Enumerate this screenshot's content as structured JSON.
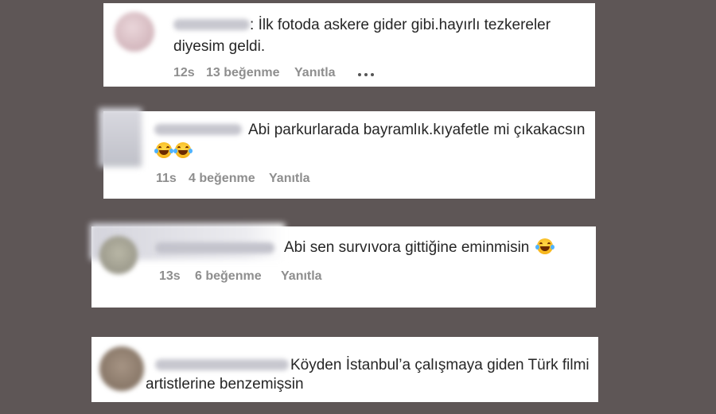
{
  "comments": [
    {
      "text_lines": [
        "İlk fotoda askere gider gibi.hayırlı tezkereler",
        "diyesim geldi."
      ],
      "name_separator": ":",
      "time": "12s",
      "likes": "13 beğenme",
      "reply": "Yanıtla"
    },
    {
      "text_lines": [
        "Abi parkurlarada bayramlık.kıyafetle mi çıkakacsın"
      ],
      "emoji_line": [
        "face-with-tears-of-joy",
        "face-with-tears-of-joy"
      ],
      "time": "11s",
      "likes": "4 beğenme",
      "reply": "Yanıtla"
    },
    {
      "text_lines": [
        "Abi sen survıvora gittiğine eminmisin"
      ],
      "trailing_emoji": "face-with-tears-of-joy",
      "time": "13s",
      "likes": "6 beğenme",
      "reply": "Yanıtla"
    },
    {
      "text_lines": [
        "Köyden İstanbul’a çalışmaya giden Türk filmi",
        "artistlerine benzemişsin"
      ]
    }
  ],
  "colors": {
    "background": "#5e5656",
    "card": "#ffffff",
    "text": "#262626",
    "meta": "#8e8e8e"
  }
}
